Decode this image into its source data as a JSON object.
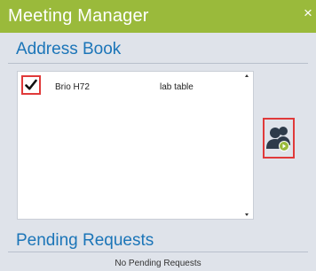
{
  "window": {
    "title": "Meeting Manager",
    "close_label": "×",
    "accent_color": "#9aba3b",
    "heading_color": "#1b75b8",
    "highlight_color": "#e03a3a"
  },
  "address_book": {
    "title": "Address Book",
    "entries": [
      {
        "name": "Brio H72",
        "location": "lab table",
        "checked": true
      }
    ]
  },
  "action_button": {
    "icon": "add-contact-icon"
  },
  "pending_requests": {
    "title": "Pending Requests",
    "status": "No Pending Requests"
  }
}
